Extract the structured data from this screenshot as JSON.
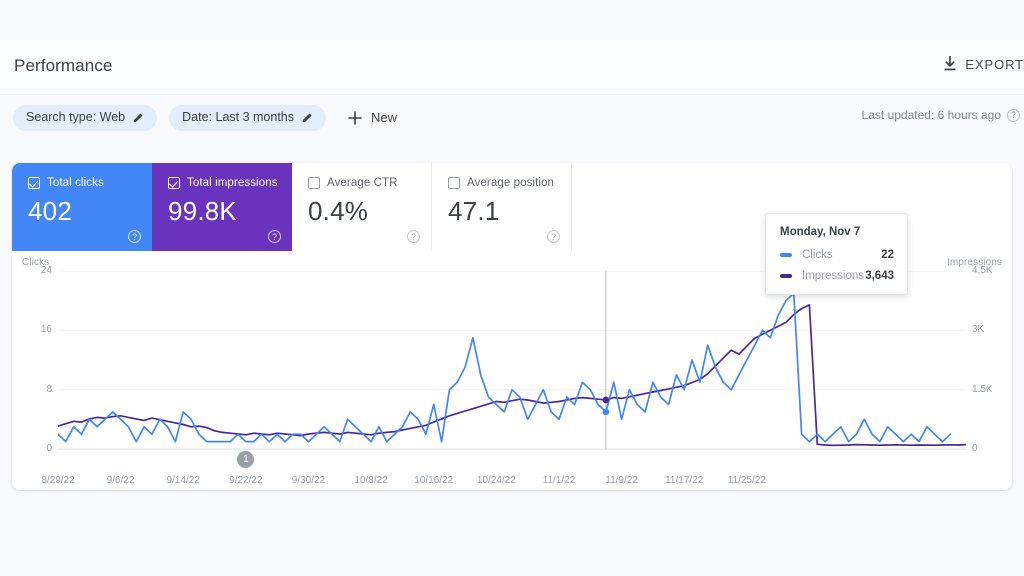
{
  "header": {
    "title": "Performance",
    "export_label": "EXPORT",
    "last_updated": "Last updated: 6 hours ago"
  },
  "filters": {
    "chips": [
      {
        "label": "Search type: Web"
      },
      {
        "label": "Date: Last 3 months"
      }
    ],
    "new_label": "New"
  },
  "metrics": [
    {
      "label": "Total clicks",
      "value": "402",
      "checked": true,
      "color": "#4387f6"
    },
    {
      "label": "Total impressions",
      "value": "99.8K",
      "checked": true,
      "color": "#6a33bd"
    },
    {
      "label": "Average CTR",
      "value": "0.4%",
      "checked": false,
      "color": "#ffffff"
    },
    {
      "label": "Average position",
      "value": "47.1",
      "checked": false,
      "color": "#ffffff"
    }
  ],
  "tooltip": {
    "date": "Monday, Nov 7",
    "rows": [
      {
        "label": "Clicks",
        "value": "22",
        "color": "#4387f6"
      },
      {
        "label": "Impressions",
        "value": "3,643",
        "color": "#49279c"
      }
    ]
  },
  "annotation": {
    "label": "1",
    "date": "9/22/22"
  },
  "chart_data": {
    "type": "line",
    "title": "Performance",
    "xlabel": "",
    "ylabel_left": "Clicks",
    "ylabel_right": "Impressions",
    "ylim_left": [
      0,
      24
    ],
    "ylim_right": [
      0,
      4500
    ],
    "yticks_left": [
      "0",
      "8",
      "16",
      "24"
    ],
    "yticks_right": [
      "0",
      "1.5K",
      "3K",
      "4.5K"
    ],
    "grid": true,
    "legend_position": "tooltip",
    "xticks": [
      "8/29/22",
      "9/6/22",
      "9/14/22",
      "9/22/22",
      "9/30/22",
      "10/8/22",
      "10/16/22",
      "10/24/22",
      "11/1/22",
      "11/9/22",
      "11/17/22",
      "11/25/22"
    ],
    "xtick_indices": [
      0,
      8,
      16,
      24,
      32,
      40,
      48,
      56,
      64,
      72,
      80,
      88
    ],
    "highlight_index": 70,
    "series": [
      {
        "name": "Clicks",
        "color": "#4387f6",
        "axis": "left",
        "values": [
          2,
          1,
          3,
          2,
          4,
          3,
          4,
          5,
          4,
          3,
          1,
          3,
          2,
          4,
          3,
          1,
          5,
          4,
          2,
          1,
          1,
          1,
          1,
          2,
          1,
          1,
          2,
          1,
          2,
          1,
          2,
          2,
          1,
          2,
          3,
          2,
          1,
          4,
          3,
          2,
          1,
          3,
          1,
          2,
          3,
          5,
          4,
          2,
          6,
          1,
          8,
          9,
          11,
          15,
          10,
          7,
          6,
          5,
          8,
          7,
          4,
          6,
          8,
          5,
          4,
          7,
          6,
          9,
          8,
          6,
          5,
          9,
          4,
          8,
          6,
          5,
          9,
          7,
          6,
          10,
          8,
          12,
          9,
          14,
          11,
          9,
          8,
          10,
          12,
          14,
          16,
          15,
          18,
          20,
          21,
          2,
          1,
          2,
          1,
          2,
          3,
          1,
          2,
          4,
          2,
          1,
          3,
          2,
          1,
          2,
          1,
          3,
          2,
          1,
          2
        ]
      },
      {
        "name": "Impressions",
        "color": "#49279c",
        "axis": "right",
        "values": [
          580,
          640,
          700,
          680,
          760,
          800,
          780,
          820,
          840,
          800,
          760,
          720,
          780,
          740,
          700,
          660,
          620,
          560,
          580,
          540,
          460,
          420,
          400,
          380,
          360,
          400,
          380,
          360,
          400,
          380,
          360,
          340,
          380,
          400,
          420,
          400,
          380,
          420,
          400,
          380,
          360,
          400,
          420,
          440,
          480,
          520,
          560,
          600,
          680,
          760,
          840,
          900,
          960,
          1020,
          1080,
          1140,
          1200,
          1180,
          1220,
          1260,
          1240,
          1200,
          1160,
          1180,
          1200,
          1240,
          1280,
          1300,
          1280,
          1260,
          1240,
          1300,
          1280,
          1320,
          1360,
          1400,
          1440,
          1480,
          1520,
          1560,
          1600,
          1680,
          1760,
          1900,
          2100,
          2300,
          2500,
          2400,
          2600,
          2800,
          2900,
          3000,
          3100,
          3200,
          3400,
          3550,
          3643,
          120,
          100,
          90,
          95,
          100,
          110,
          105,
          100,
          95,
          100,
          105,
          100,
          95,
          100,
          98,
          95,
          100,
          105,
          100,
          110
        ]
      }
    ]
  }
}
